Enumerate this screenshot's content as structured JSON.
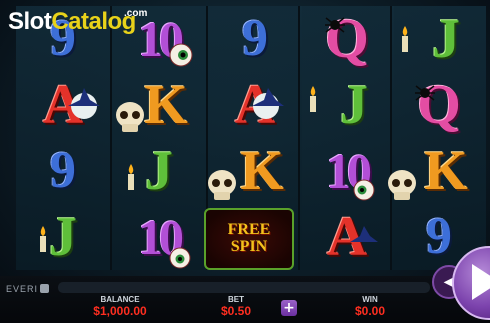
{
  "logo": {
    "part1": "Slot",
    "part2": "Catalog",
    "domain": ".com"
  },
  "brand": "EVERI",
  "reels": [
    [
      "9",
      "A",
      "9",
      "J"
    ],
    [
      "10",
      "K",
      "J",
      "10"
    ],
    [
      "9",
      "A",
      "K",
      "FREE SPIN"
    ],
    [
      "Q",
      "J",
      "10",
      "A"
    ],
    [
      "J",
      "Q",
      "K",
      "9"
    ]
  ],
  "free_spin": {
    "line1": "FREE",
    "line2": "SPIN"
  },
  "footer": {
    "balance_label": "BALANCE",
    "balance_value": "$1,000.00",
    "bet_label": "BET",
    "bet_value": "$0.50",
    "win_label": "WIN",
    "win_value": "$0.00"
  },
  "icons": {
    "plus": "plus-icon",
    "autoplay": "chevron-left-icon",
    "spin": "play-icon",
    "skull": "skull-icon",
    "eyeball": "eyeball-icon",
    "candle": "candle-icon",
    "spider": "spider-icon",
    "hat": "witch-hat-icon"
  },
  "colors": {
    "accent_red": "#ff2e20",
    "spin_purple": "#7c43ad"
  }
}
